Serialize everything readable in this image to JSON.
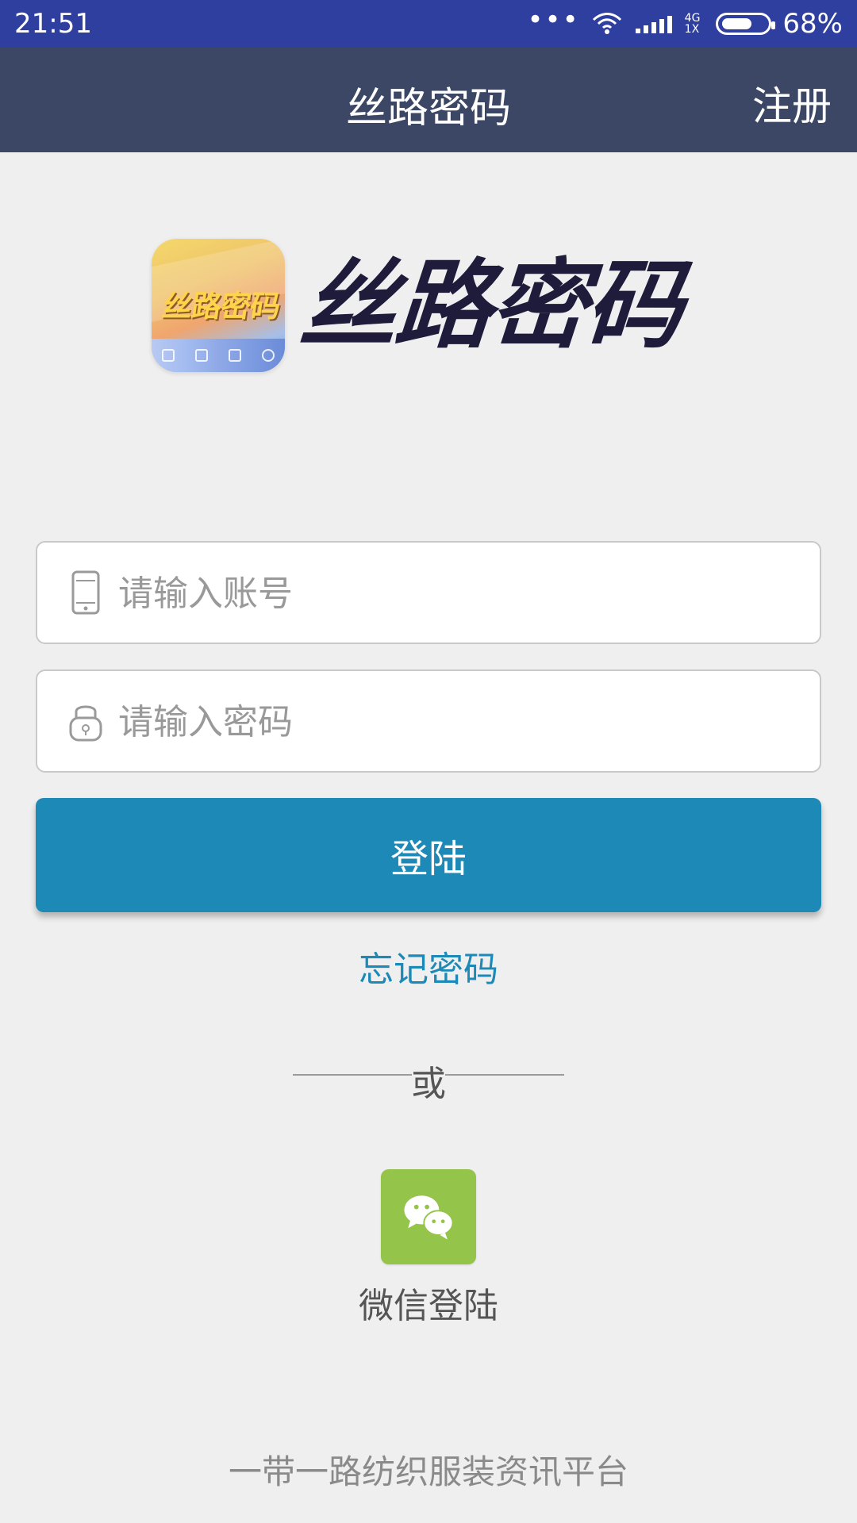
{
  "status_bar": {
    "time": "21:51",
    "network_top": "4G",
    "network_bottom": "1X",
    "battery_percent": "68%",
    "battery_level": 0.68
  },
  "app_bar": {
    "title": "丝路密码",
    "register_label": "注册"
  },
  "brand": {
    "logo_text": "丝路密码",
    "wordmark": "丝路密码",
    "colors": {
      "wordmark": "#1f1b3a"
    }
  },
  "login_form": {
    "account_placeholder": "请输入账号",
    "password_placeholder": "请输入密码",
    "login_label": "登陆",
    "forgot_label": "忘记密码",
    "icons": {
      "account": "phone-icon",
      "password": "lock-icon"
    },
    "colors": {
      "primary": "#1d89b6"
    }
  },
  "alternatives": {
    "divider_text": "或",
    "wechat_label": "微信登陆",
    "wechat_icon": "wechat-icon",
    "colors": {
      "wechat": "#95c44a"
    }
  },
  "footer": {
    "tagline": "一带一路纺织服装资讯平台"
  }
}
